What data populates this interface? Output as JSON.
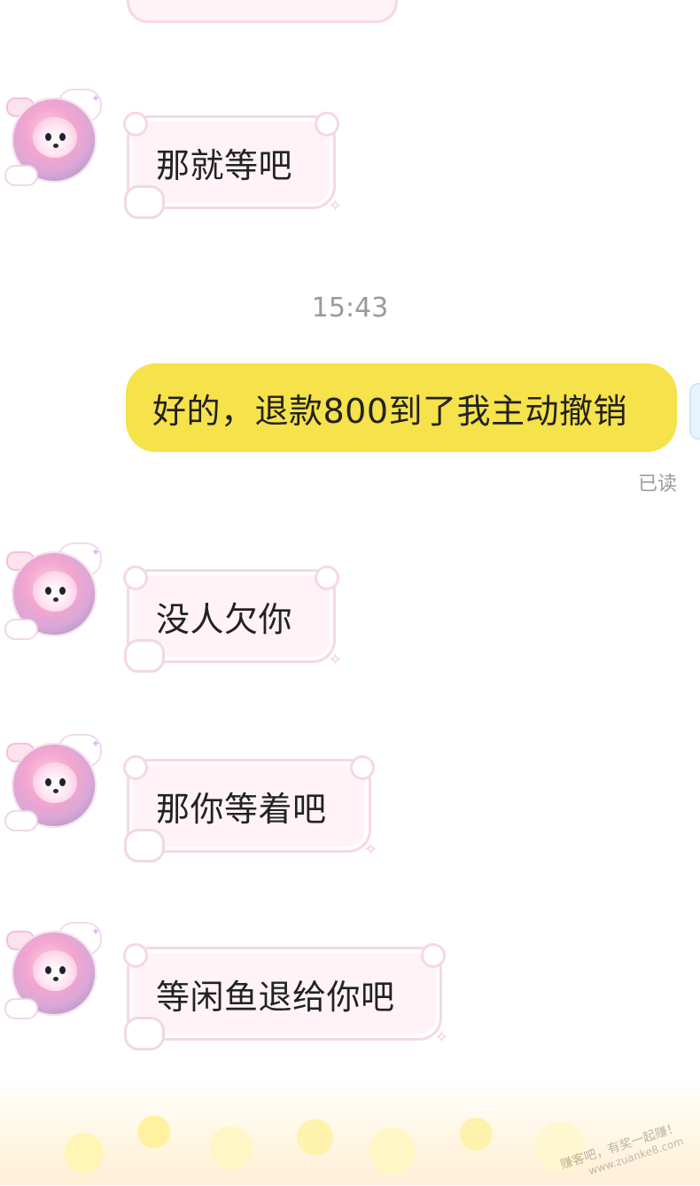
{
  "timestamp": "15:43",
  "incoming": [
    {
      "text": "那就等吧"
    },
    {
      "text": "没人欠你"
    },
    {
      "text": "那你等着吧"
    },
    {
      "text": "等闲鱼退给你吧"
    }
  ],
  "outgoing": [
    {
      "text": "好的，退款800到了我主动撤销",
      "status": "已读"
    }
  ],
  "watermark": {
    "line1": "赚客吧，有奖一起赚！",
    "line2": "www.zuanke8.com"
  }
}
